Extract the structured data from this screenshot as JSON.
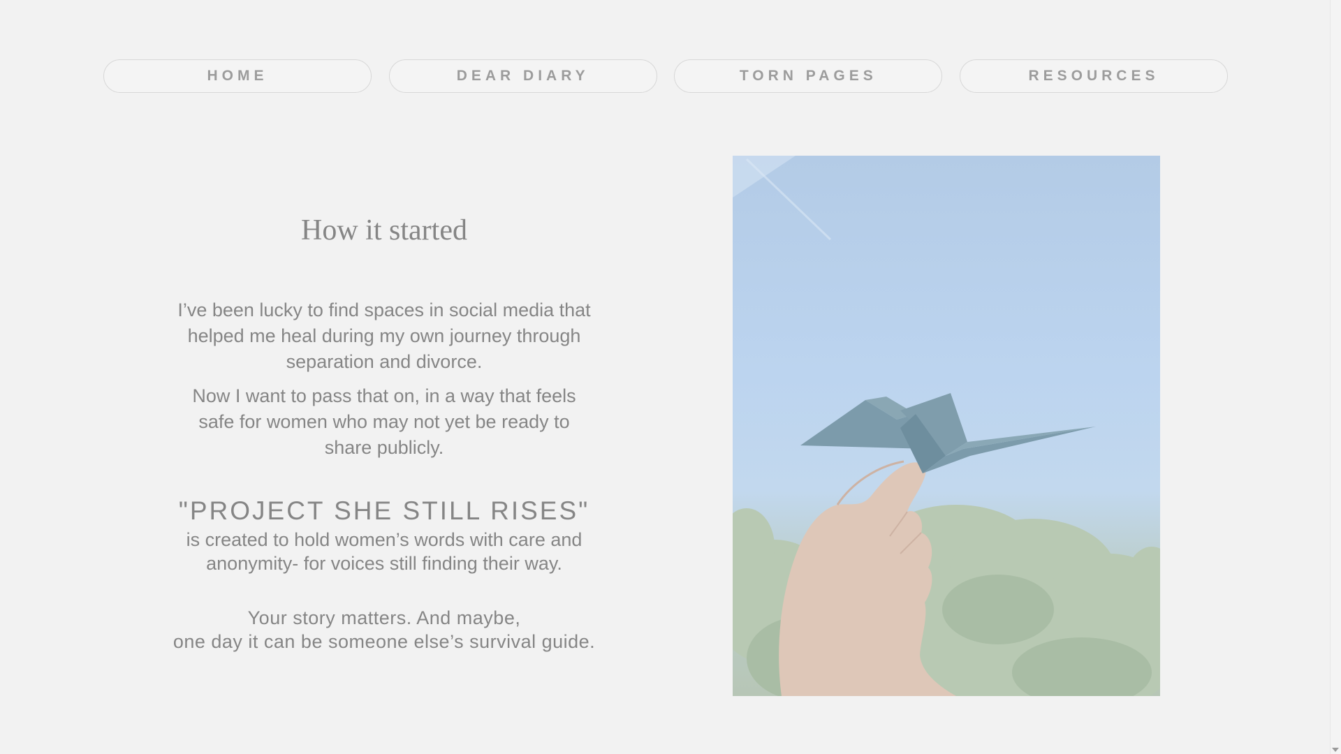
{
  "nav": {
    "items": [
      {
        "label": "HOME"
      },
      {
        "label": "DEAR DIARY"
      },
      {
        "label": "TORN PAGES"
      },
      {
        "label": "RESOURCES"
      }
    ]
  },
  "main": {
    "title": "How it started",
    "paragraph1": "I’ve been lucky to find spaces in social media that helped me heal during my own journey through separation and divorce.",
    "paragraph2": "Now I want to pass that on, in a way that feels safe for women who may not yet be ready to share publicly.",
    "project_title": "\"PROJECT SHE STILL RISES\"",
    "project_text": "is created to hold women’s words with care and anonymity- for voices still finding their way.",
    "story_line1": "Your story matters. And maybe,",
    "story_line2": "one day it can be someone else’s survival guide."
  },
  "image": {
    "subject": "hand holding origami paper crane against blue sky and trees"
  },
  "colors": {
    "background": "#f2f2f2",
    "text": "#858585",
    "nav_text": "#9c9c9c"
  }
}
